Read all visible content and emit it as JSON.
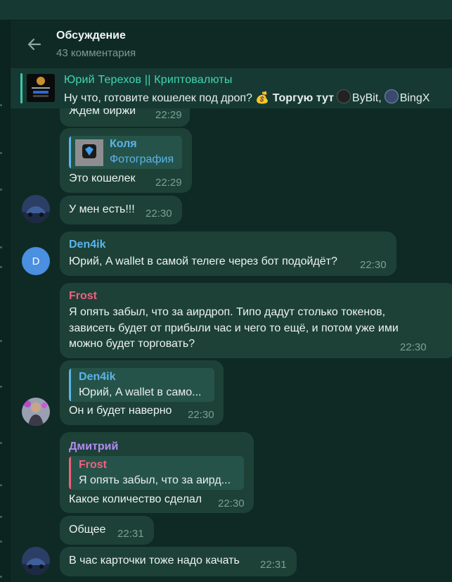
{
  "header": {
    "title": "Обсуждение",
    "subtitle": "43 комментария"
  },
  "pinned": {
    "channel": "Юрий Терехов || Криптовалюты",
    "text_prefix": "Ну что, готовите кошелек под дроп? ",
    "emoji": "💰",
    "bold": "Торгую тут",
    "exchange1": "ByBit,",
    "exchange2": "BingX"
  },
  "messages": [
    {
      "text": "Ждем биржи",
      "time": "22:29"
    },
    {
      "reply_name": "Коля",
      "reply_text": "Фотография",
      "text": "Это кошелек",
      "time": "22:29"
    },
    {
      "text": "У мен есть!!!",
      "time": "22:30"
    },
    {
      "sender": "Den4ik",
      "avatar_letter": "D",
      "text": "Юрий, A wallet в самой телеге через бот подойдёт?",
      "time": "22:30"
    },
    {
      "sender": "Frost",
      "lines": [
        "Я опять забыл, что за аирдроп. Типо дадут столько токенов,",
        "зависеть будет от прибыли час и чего то ещё, и потом уже ими",
        "можно будет торговать?"
      ],
      "time": "22:30"
    },
    {
      "reply_name": "Den4ik",
      "reply_text": "Юрий, A wallet в само...",
      "text": "Он и будет наверно",
      "time": "22:30"
    },
    {
      "sender": "Дмитрий",
      "reply_name": "Frost",
      "reply_text": "Я опять забыл, что за аирд...",
      "text": "Какое количество сделал",
      "time": "22:30"
    },
    {
      "text": "Общее",
      "time": "22:31"
    },
    {
      "text": "В час карточки тоже надо качать",
      "time": "22:31"
    }
  ],
  "colors": {
    "background": "#0f2a25",
    "bubble": "#1d4137",
    "accent": "#42d6b4",
    "den4ik": "#5ab4ea",
    "frost": "#f0607e",
    "dmitry": "#b38bf2",
    "time": "#7aa196"
  }
}
